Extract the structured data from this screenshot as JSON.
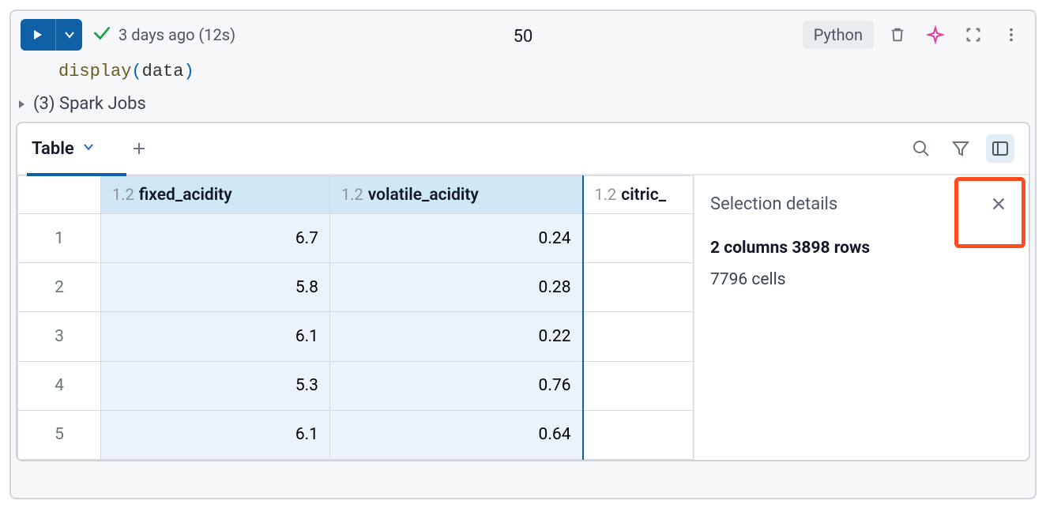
{
  "toolbar": {
    "status_time": "3 days ago (12s)",
    "center_number": "50",
    "language": "Python"
  },
  "code": {
    "func": "display",
    "paren_open": "(",
    "var": "data",
    "paren_close": ")"
  },
  "spark": {
    "label": "(3) Spark Jobs"
  },
  "tabs": {
    "active_label": "Table"
  },
  "chart_data": {
    "type": "table",
    "columns": [
      {
        "type_label": "1.2",
        "name": "fixed_acidity",
        "selected": true
      },
      {
        "type_label": "1.2",
        "name": "volatile_acidity",
        "selected": true
      },
      {
        "type_label": "1.2",
        "name": "citric_",
        "selected": false
      }
    ],
    "rows": [
      {
        "n": "1",
        "fixed_acidity": "6.7",
        "volatile_acidity": "0.24"
      },
      {
        "n": "2",
        "fixed_acidity": "5.8",
        "volatile_acidity": "0.28"
      },
      {
        "n": "3",
        "fixed_acidity": "6.1",
        "volatile_acidity": "0.22"
      },
      {
        "n": "4",
        "fixed_acidity": "5.3",
        "volatile_acidity": "0.76"
      },
      {
        "n": "5",
        "fixed_acidity": "6.1",
        "volatile_acidity": "0.64"
      }
    ]
  },
  "selection": {
    "title": "Selection details",
    "summary": "2 columns 3898 rows",
    "cells": "7796 cells"
  }
}
